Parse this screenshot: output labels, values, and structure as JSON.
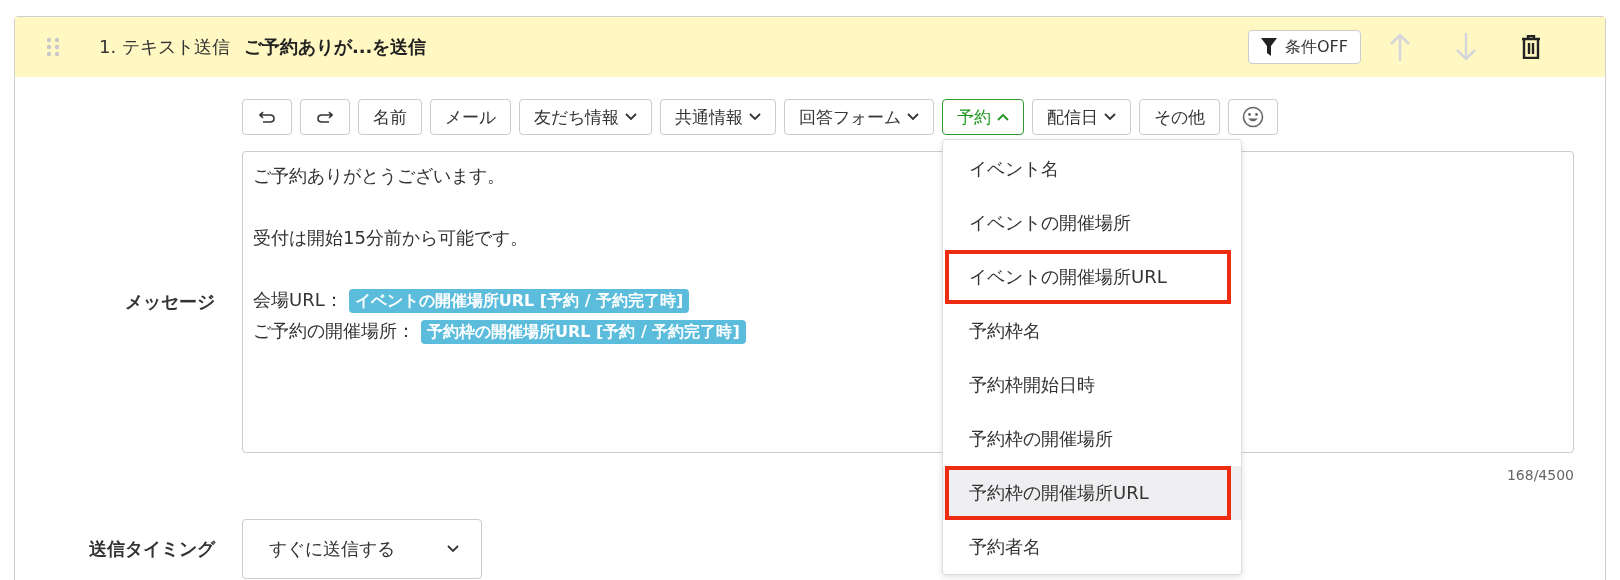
{
  "step": {
    "number": "1. テキスト送信",
    "title": "ご予約ありが...を送信",
    "condition_button": "条件OFF",
    "move_up_disabled": true,
    "move_down_disabled": true
  },
  "toolbar": [
    {
      "kind": "undo"
    },
    {
      "kind": "redo"
    },
    {
      "kind": "text",
      "label": "名前"
    },
    {
      "kind": "text",
      "label": "メール"
    },
    {
      "kind": "menu",
      "label": "友だち情報",
      "expanded": false
    },
    {
      "kind": "menu",
      "label": "共通情報",
      "expanded": false
    },
    {
      "kind": "menu",
      "label": "回答フォーム",
      "expanded": false
    },
    {
      "kind": "menu",
      "label": "予約",
      "expanded": true
    },
    {
      "kind": "menu",
      "label": "配信日",
      "expanded": false
    },
    {
      "kind": "text",
      "label": "その他"
    },
    {
      "kind": "emoji"
    }
  ],
  "dropdown_items": [
    {
      "label": "イベント名",
      "selected": false,
      "highlighted": false
    },
    {
      "label": "イベントの開催場所",
      "selected": false,
      "highlighted": false
    },
    {
      "label": "イベントの開催場所URL",
      "selected": false,
      "highlighted": true
    },
    {
      "label": "予約枠名",
      "selected": false,
      "highlighted": false
    },
    {
      "label": "予約枠開始日時",
      "selected": false,
      "highlighted": false
    },
    {
      "label": "予約枠の開催場所",
      "selected": false,
      "highlighted": false
    },
    {
      "label": "予約枠の開催場所URL",
      "selected": true,
      "highlighted": true
    },
    {
      "label": "予約者名",
      "selected": false,
      "highlighted": false
    }
  ],
  "message": {
    "label": "メッセージ",
    "paragraphs": [
      {
        "lines": [
          {
            "text": "ご予約ありがとうございます。"
          }
        ]
      },
      {
        "lines": [
          {
            "text": "受付は開始15分前から可能です。"
          }
        ]
      },
      {
        "lines": [
          {
            "text": "会場URL：",
            "tag": "イベントの開催場所URL [予約 / 予約完了時]"
          },
          {
            "text": "ご予約の開催場所：",
            "tag": "予約枠の開催場所URL [予約 / 予約完了時]"
          }
        ]
      }
    ],
    "counter": "168/4500"
  },
  "timing": {
    "label": "送信タイミング",
    "value": "すぐに送信する"
  }
}
